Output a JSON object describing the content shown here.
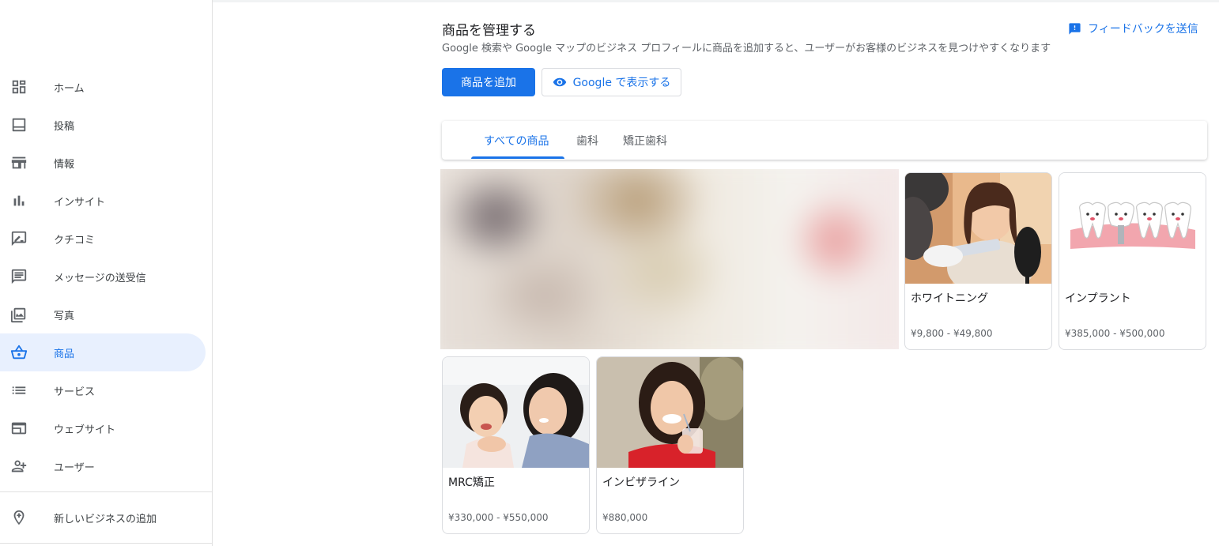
{
  "sidebar": {
    "items": [
      {
        "label": "ホーム",
        "icon": "dashboard-icon"
      },
      {
        "label": "投稿",
        "icon": "post-icon"
      },
      {
        "label": "情報",
        "icon": "store-icon"
      },
      {
        "label": "インサイト",
        "icon": "bar-chart-icon"
      },
      {
        "label": "クチコミ",
        "icon": "review-icon"
      },
      {
        "label": "メッセージの送受信",
        "icon": "message-icon"
      },
      {
        "label": "写真",
        "icon": "photo-icon"
      },
      {
        "label": "商品",
        "icon": "basket-icon",
        "active": true
      },
      {
        "label": "サービス",
        "icon": "list-icon"
      },
      {
        "label": "ウェブサイト",
        "icon": "website-icon"
      },
      {
        "label": "ユーザー",
        "icon": "add-user-icon"
      }
    ],
    "add_business": {
      "label": "新しいビジネスの追加",
      "icon": "add-location-icon"
    }
  },
  "header": {
    "title": "商品を管理する",
    "subtitle": "Google 検索や Google マップのビジネス プロフィールに商品を追加すると、ユーザーがお客様のビジネスを見つけやすくなります",
    "feedback_label": "フィードバックを送信",
    "add_product_label": "商品を追加",
    "view_on_google_label": "Google で表示する"
  },
  "tabs": [
    {
      "label": "すべての商品",
      "active": true
    },
    {
      "label": "歯科"
    },
    {
      "label": "矯正歯科"
    }
  ],
  "products": [
    {
      "name": "ホワイトニング",
      "price": "¥9,800 - ¥49,800"
    },
    {
      "name": "インプラント",
      "price": "¥385,000 - ¥500,000"
    },
    {
      "name": "MRC矯正",
      "price": "¥330,000 - ¥550,000"
    },
    {
      "name": "インビザライン",
      "price": "¥880,000"
    }
  ],
  "colors": {
    "accent": "#1a73e8",
    "active_nav_bg": "#e8f0fe"
  }
}
